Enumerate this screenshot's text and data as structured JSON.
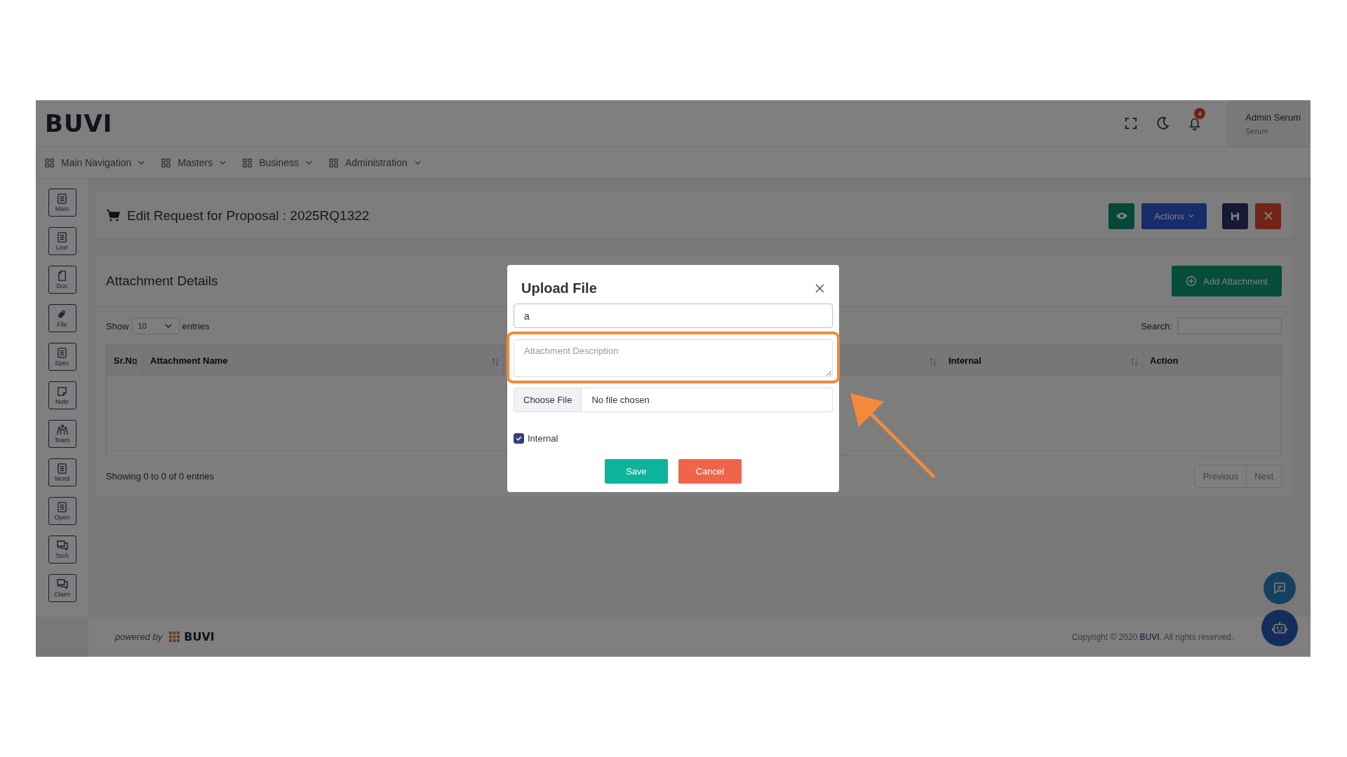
{
  "brand": {
    "logo": "BUVI"
  },
  "nav": [
    {
      "label": "Main Navigation"
    },
    {
      "label": "Masters"
    },
    {
      "label": "Business"
    },
    {
      "label": "Administration"
    }
  ],
  "header": {
    "notifications": "4",
    "user": {
      "name": "Admin Serum",
      "role": "Serum"
    }
  },
  "sidebar": [
    {
      "label": "Main",
      "kind": "list"
    },
    {
      "label": "Line",
      "kind": "list"
    },
    {
      "label": "Doc",
      "kind": "page"
    },
    {
      "label": "File",
      "kind": "clip"
    },
    {
      "label": "Spec",
      "kind": "list"
    },
    {
      "label": "Note",
      "kind": "note"
    },
    {
      "label": "Team",
      "kind": "team"
    },
    {
      "label": "Word",
      "kind": "list"
    },
    {
      "label": "Open",
      "kind": "list"
    },
    {
      "label": "Tech",
      "kind": "chat"
    },
    {
      "label": "Claim",
      "kind": "chat"
    }
  ],
  "page": {
    "title": "Edit Request for Proposal : 2025RQ1322",
    "actions_label": "Actions"
  },
  "attachments": {
    "title": "Attachment Details",
    "add_label": "Add Attachment",
    "show_label": "Show",
    "page_size": "10",
    "entries_label": "entries",
    "search_label": "Search:",
    "columns": [
      {
        "label": "Sr.No",
        "sortable": true
      },
      {
        "label": "Attachment Name",
        "sortable": true
      },
      {
        "sortable": true
      },
      {
        "label": "Internal",
        "sortable": true
      },
      {
        "label": "Action",
        "sortable": false
      }
    ],
    "info": "Showing 0 to 0 of 0 entries",
    "pager": [
      {
        "label": "Previous",
        "disabled": true
      },
      {
        "label": "Next",
        "disabled": true
      }
    ]
  },
  "footer": {
    "powered_by": "powered by",
    "logo": "BUVI",
    "copyright_before": "Copyright © 2020",
    "copyright_link": "BUVI",
    "copyright_after": ". All rights reserved."
  },
  "modal": {
    "title": "Upload File",
    "name_value": "a",
    "description_placeholder": "Attachment Description",
    "choose_file": "Choose File",
    "file_status": "No file chosen",
    "internal": {
      "label": "Internal",
      "checked": true
    },
    "save": "Save",
    "cancel": "Cancel"
  }
}
